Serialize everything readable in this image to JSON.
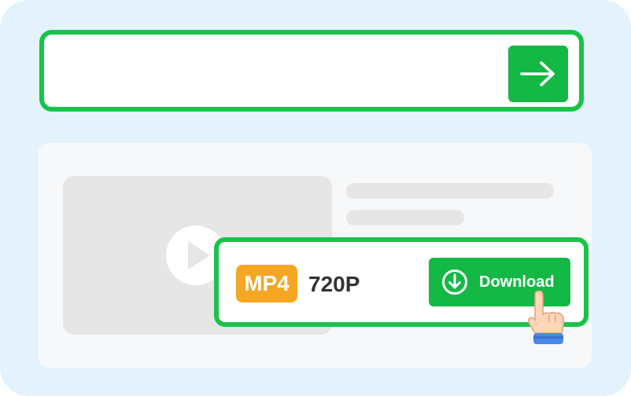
{
  "colors": {
    "frame_background": "#e3f2fd",
    "accent_green": "#19c34a",
    "button_green": "#14b845",
    "format_badge": "#f5a623",
    "placeholder_gray": "#e6e6e6"
  },
  "url_bar": {
    "value": "",
    "go_icon": "arrow-right-icon"
  },
  "video_card": {
    "thumbnail_icon": "play-icon"
  },
  "download_option": {
    "format": "MP4",
    "quality": "720P",
    "button_label": "Download",
    "button_icon": "download-arrow-icon",
    "cursor_icon": "pointing-hand-icon"
  }
}
